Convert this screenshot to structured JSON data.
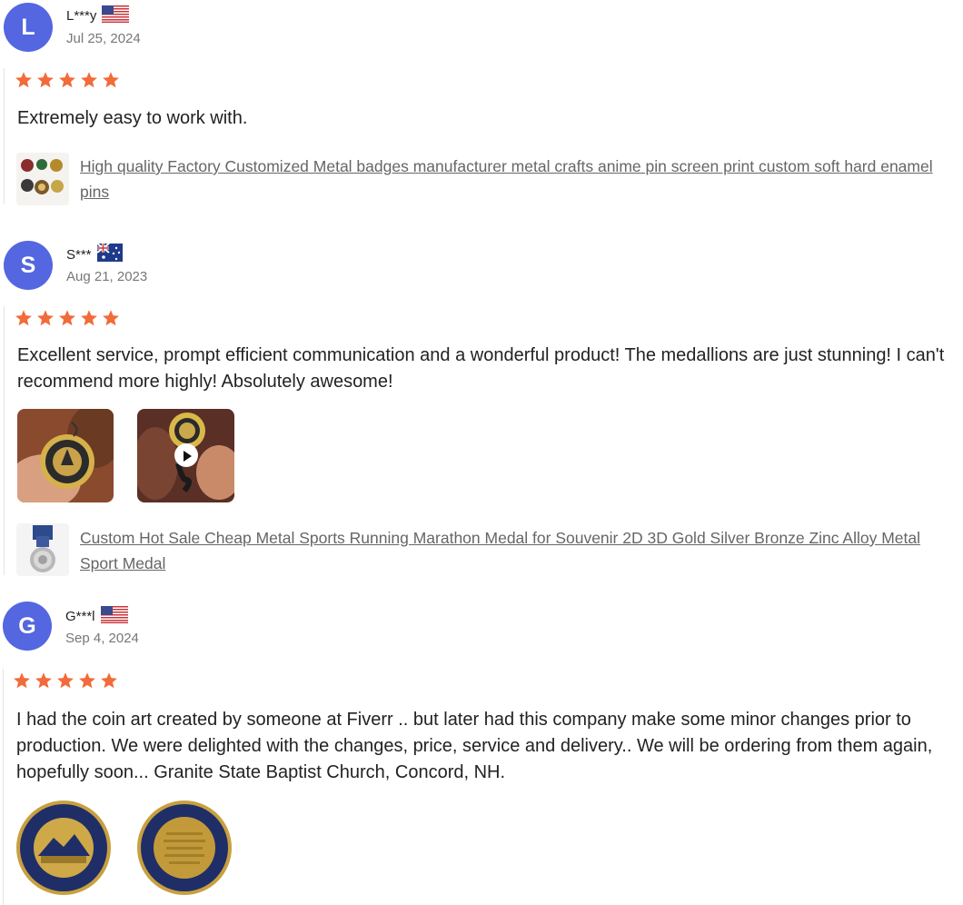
{
  "reviews": [
    {
      "initial": "L",
      "name": "L***y",
      "country_flag": "us-flag-icon",
      "date": "Jul 25, 2024",
      "rating": 5,
      "text": "Extremely easy to work with.",
      "product_link": "High quality Factory Customized Metal badges manufacturer metal crafts anime pin screen print custom soft hard enamel pins"
    },
    {
      "initial": "S",
      "name": "S***",
      "country_flag": "au-flag-icon",
      "date": "Aug 21, 2023",
      "rating": 5,
      "text": "Excellent service, prompt efficient communication and a wonderful product! The medallions are just stunning! I can't recommend more highly! Absolutely awesome!",
      "product_link": "Custom Hot Sale Cheap Metal Sports Running Marathon Medal for Souvenir 2D 3D Gold Silver Bronze Zinc Alloy Metal Sport Medal"
    },
    {
      "initial": "G",
      "name": "G***l",
      "country_flag": "us-flag-icon",
      "date": "Sep 4, 2024",
      "rating": 5,
      "text": "I had the coin art created by someone at Fiverr .. but later had this company make some minor changes prior to production. We were delighted with the changes, price, service and delivery.. We will be ordering from them again, hopefully soon... Granite State Baptist Church, Concord, NH."
    }
  ],
  "colors": {
    "avatar": "#5466e0",
    "star": "#f26b3a",
    "link": "#666666",
    "date": "#777777"
  }
}
